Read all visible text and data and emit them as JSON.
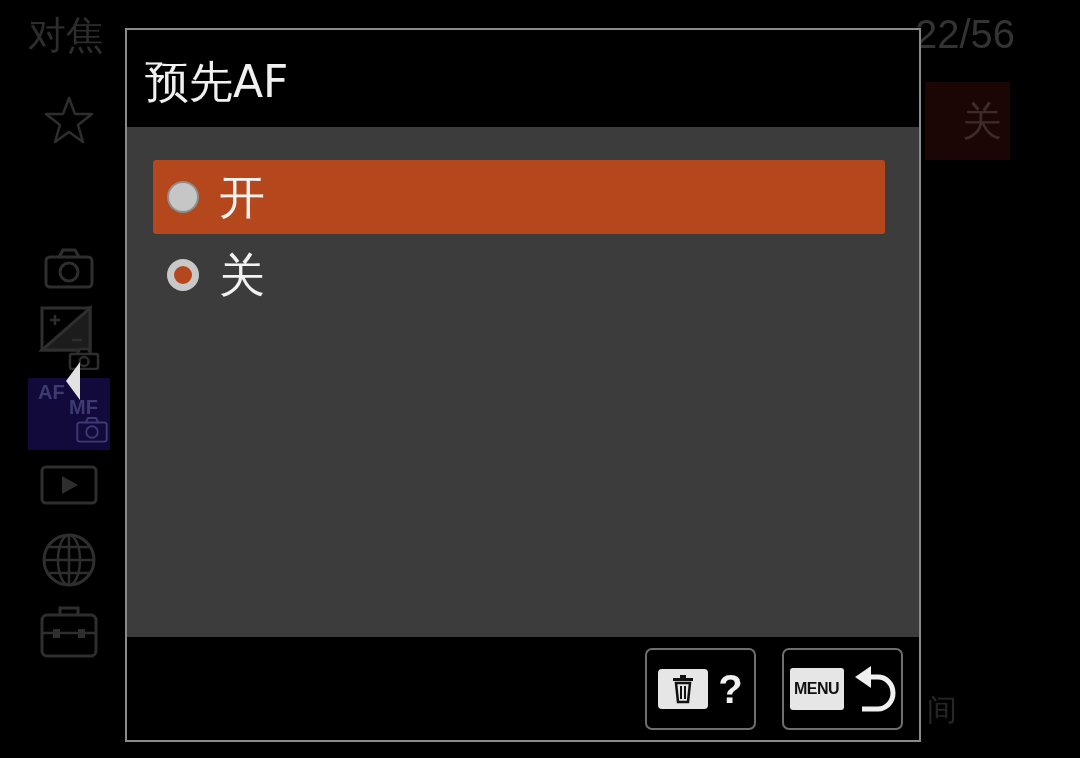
{
  "background_menu": {
    "breadcrumb": "对焦",
    "page_indicator": "22/56",
    "tabs": [
      {
        "kind": "star",
        "selected": false
      },
      {
        "kind": "camera",
        "selected": false
      },
      {
        "kind": "exposure",
        "selected": false
      },
      {
        "kind": "af-mf",
        "selected": true,
        "labels": [
          "AF",
          "MF"
        ]
      },
      {
        "kind": "playback",
        "selected": false
      },
      {
        "kind": "globe",
        "selected": false
      },
      {
        "kind": "toolbox",
        "selected": false
      }
    ],
    "current_value": "关",
    "lower_right_text": "间"
  },
  "dialog": {
    "title": "预先AF",
    "options": [
      {
        "label": "开",
        "highlighted": true,
        "selected": false
      },
      {
        "label": "关",
        "highlighted": false,
        "selected": true
      }
    ],
    "buttons": [
      {
        "kind": "delete-help",
        "label": "?"
      },
      {
        "kind": "menu-back",
        "key_label": "MENU"
      }
    ]
  }
}
